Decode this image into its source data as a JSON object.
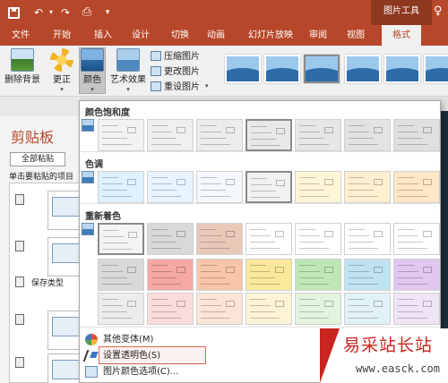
{
  "titlebar": {
    "context_label": "图片工具"
  },
  "tabs": [
    {
      "label": "文件",
      "active": false
    },
    {
      "label": "开始",
      "active": false
    },
    {
      "label": "插入",
      "active": false
    },
    {
      "label": "设计",
      "active": false
    },
    {
      "label": "切换",
      "active": false
    },
    {
      "label": "动画",
      "active": false
    },
    {
      "label": "幻灯片放映",
      "active": false
    },
    {
      "label": "审阅",
      "active": false
    },
    {
      "label": "视图",
      "active": false
    },
    {
      "label": "格式",
      "active": true
    }
  ],
  "ribbon": {
    "remove_background": "删除背景",
    "corrections": "更正",
    "color": "颜色",
    "artistic_effects": "艺术效果",
    "compress": "压缩图片",
    "change": "更改图片",
    "reset": "重设图片"
  },
  "clipboard": {
    "title": "剪贴板",
    "paste_all": "全部粘贴",
    "hint": "单击要粘贴的项目",
    "save_type": "保存类型"
  },
  "color_menu": {
    "saturation_title": "颜色饱和度",
    "tone_title": "色调",
    "recolor_title": "重新着色",
    "more_variants": "其他变体(M)",
    "set_transparent": "设置透明色(S)",
    "options": "图片颜色选项(C)..."
  },
  "colors": {
    "accent": "#b7472a",
    "highlight": "#e06458"
  },
  "watermark": {
    "title": "易采站长站",
    "url": "www.easck.com"
  }
}
